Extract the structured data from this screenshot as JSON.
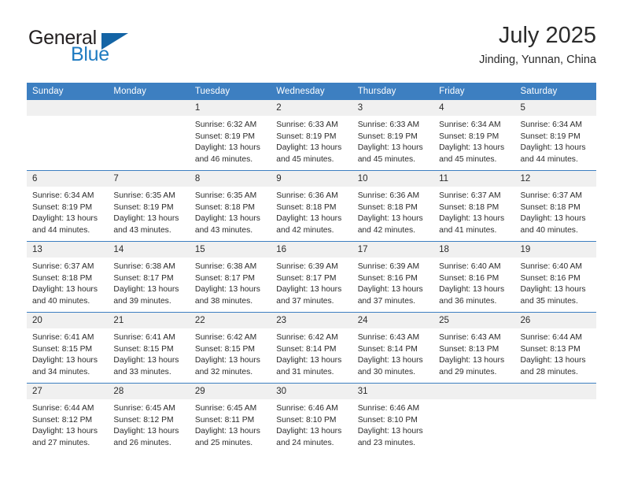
{
  "brand": {
    "name_top": "General",
    "name_bottom": "Blue",
    "color_dark": "#231f20",
    "color_blue": "#1f7bc1",
    "triangle_color": "#1464a5"
  },
  "header": {
    "title": "July 2025",
    "subtitle": "Jinding, Yunnan, China"
  },
  "theme": {
    "header_bar": "#3d7fc1",
    "daynum_bg": "#f0f0f0",
    "text": "#2b2b2b"
  },
  "weekday_headers": [
    "Sunday",
    "Monday",
    "Tuesday",
    "Wednesday",
    "Thursday",
    "Friday",
    "Saturday"
  ],
  "weeks": [
    [
      {
        "day": "",
        "sunrise": "",
        "sunset": "",
        "daylight_line1": "",
        "daylight_line2": ""
      },
      {
        "day": "",
        "sunrise": "",
        "sunset": "",
        "daylight_line1": "",
        "daylight_line2": ""
      },
      {
        "day": "1",
        "sunrise": "Sunrise: 6:32 AM",
        "sunset": "Sunset: 8:19 PM",
        "daylight_line1": "Daylight: 13 hours",
        "daylight_line2": "and 46 minutes."
      },
      {
        "day": "2",
        "sunrise": "Sunrise: 6:33 AM",
        "sunset": "Sunset: 8:19 PM",
        "daylight_line1": "Daylight: 13 hours",
        "daylight_line2": "and 45 minutes."
      },
      {
        "day": "3",
        "sunrise": "Sunrise: 6:33 AM",
        "sunset": "Sunset: 8:19 PM",
        "daylight_line1": "Daylight: 13 hours",
        "daylight_line2": "and 45 minutes."
      },
      {
        "day": "4",
        "sunrise": "Sunrise: 6:34 AM",
        "sunset": "Sunset: 8:19 PM",
        "daylight_line1": "Daylight: 13 hours",
        "daylight_line2": "and 45 minutes."
      },
      {
        "day": "5",
        "sunrise": "Sunrise: 6:34 AM",
        "sunset": "Sunset: 8:19 PM",
        "daylight_line1": "Daylight: 13 hours",
        "daylight_line2": "and 44 minutes."
      }
    ],
    [
      {
        "day": "6",
        "sunrise": "Sunrise: 6:34 AM",
        "sunset": "Sunset: 8:19 PM",
        "daylight_line1": "Daylight: 13 hours",
        "daylight_line2": "and 44 minutes."
      },
      {
        "day": "7",
        "sunrise": "Sunrise: 6:35 AM",
        "sunset": "Sunset: 8:19 PM",
        "daylight_line1": "Daylight: 13 hours",
        "daylight_line2": "and 43 minutes."
      },
      {
        "day": "8",
        "sunrise": "Sunrise: 6:35 AM",
        "sunset": "Sunset: 8:18 PM",
        "daylight_line1": "Daylight: 13 hours",
        "daylight_line2": "and 43 minutes."
      },
      {
        "day": "9",
        "sunrise": "Sunrise: 6:36 AM",
        "sunset": "Sunset: 8:18 PM",
        "daylight_line1": "Daylight: 13 hours",
        "daylight_line2": "and 42 minutes."
      },
      {
        "day": "10",
        "sunrise": "Sunrise: 6:36 AM",
        "sunset": "Sunset: 8:18 PM",
        "daylight_line1": "Daylight: 13 hours",
        "daylight_line2": "and 42 minutes."
      },
      {
        "day": "11",
        "sunrise": "Sunrise: 6:37 AM",
        "sunset": "Sunset: 8:18 PM",
        "daylight_line1": "Daylight: 13 hours",
        "daylight_line2": "and 41 minutes."
      },
      {
        "day": "12",
        "sunrise": "Sunrise: 6:37 AM",
        "sunset": "Sunset: 8:18 PM",
        "daylight_line1": "Daylight: 13 hours",
        "daylight_line2": "and 40 minutes."
      }
    ],
    [
      {
        "day": "13",
        "sunrise": "Sunrise: 6:37 AM",
        "sunset": "Sunset: 8:18 PM",
        "daylight_line1": "Daylight: 13 hours",
        "daylight_line2": "and 40 minutes."
      },
      {
        "day": "14",
        "sunrise": "Sunrise: 6:38 AM",
        "sunset": "Sunset: 8:17 PM",
        "daylight_line1": "Daylight: 13 hours",
        "daylight_line2": "and 39 minutes."
      },
      {
        "day": "15",
        "sunrise": "Sunrise: 6:38 AM",
        "sunset": "Sunset: 8:17 PM",
        "daylight_line1": "Daylight: 13 hours",
        "daylight_line2": "and 38 minutes."
      },
      {
        "day": "16",
        "sunrise": "Sunrise: 6:39 AM",
        "sunset": "Sunset: 8:17 PM",
        "daylight_line1": "Daylight: 13 hours",
        "daylight_line2": "and 37 minutes."
      },
      {
        "day": "17",
        "sunrise": "Sunrise: 6:39 AM",
        "sunset": "Sunset: 8:16 PM",
        "daylight_line1": "Daylight: 13 hours",
        "daylight_line2": "and 37 minutes."
      },
      {
        "day": "18",
        "sunrise": "Sunrise: 6:40 AM",
        "sunset": "Sunset: 8:16 PM",
        "daylight_line1": "Daylight: 13 hours",
        "daylight_line2": "and 36 minutes."
      },
      {
        "day": "19",
        "sunrise": "Sunrise: 6:40 AM",
        "sunset": "Sunset: 8:16 PM",
        "daylight_line1": "Daylight: 13 hours",
        "daylight_line2": "and 35 minutes."
      }
    ],
    [
      {
        "day": "20",
        "sunrise": "Sunrise: 6:41 AM",
        "sunset": "Sunset: 8:15 PM",
        "daylight_line1": "Daylight: 13 hours",
        "daylight_line2": "and 34 minutes."
      },
      {
        "day": "21",
        "sunrise": "Sunrise: 6:41 AM",
        "sunset": "Sunset: 8:15 PM",
        "daylight_line1": "Daylight: 13 hours",
        "daylight_line2": "and 33 minutes."
      },
      {
        "day": "22",
        "sunrise": "Sunrise: 6:42 AM",
        "sunset": "Sunset: 8:15 PM",
        "daylight_line1": "Daylight: 13 hours",
        "daylight_line2": "and 32 minutes."
      },
      {
        "day": "23",
        "sunrise": "Sunrise: 6:42 AM",
        "sunset": "Sunset: 8:14 PM",
        "daylight_line1": "Daylight: 13 hours",
        "daylight_line2": "and 31 minutes."
      },
      {
        "day": "24",
        "sunrise": "Sunrise: 6:43 AM",
        "sunset": "Sunset: 8:14 PM",
        "daylight_line1": "Daylight: 13 hours",
        "daylight_line2": "and 30 minutes."
      },
      {
        "day": "25",
        "sunrise": "Sunrise: 6:43 AM",
        "sunset": "Sunset: 8:13 PM",
        "daylight_line1": "Daylight: 13 hours",
        "daylight_line2": "and 29 minutes."
      },
      {
        "day": "26",
        "sunrise": "Sunrise: 6:44 AM",
        "sunset": "Sunset: 8:13 PM",
        "daylight_line1": "Daylight: 13 hours",
        "daylight_line2": "and 28 minutes."
      }
    ],
    [
      {
        "day": "27",
        "sunrise": "Sunrise: 6:44 AM",
        "sunset": "Sunset: 8:12 PM",
        "daylight_line1": "Daylight: 13 hours",
        "daylight_line2": "and 27 minutes."
      },
      {
        "day": "28",
        "sunrise": "Sunrise: 6:45 AM",
        "sunset": "Sunset: 8:12 PM",
        "daylight_line1": "Daylight: 13 hours",
        "daylight_line2": "and 26 minutes."
      },
      {
        "day": "29",
        "sunrise": "Sunrise: 6:45 AM",
        "sunset": "Sunset: 8:11 PM",
        "daylight_line1": "Daylight: 13 hours",
        "daylight_line2": "and 25 minutes."
      },
      {
        "day": "30",
        "sunrise": "Sunrise: 6:46 AM",
        "sunset": "Sunset: 8:10 PM",
        "daylight_line1": "Daylight: 13 hours",
        "daylight_line2": "and 24 minutes."
      },
      {
        "day": "31",
        "sunrise": "Sunrise: 6:46 AM",
        "sunset": "Sunset: 8:10 PM",
        "daylight_line1": "Daylight: 13 hours",
        "daylight_line2": "and 23 minutes."
      },
      {
        "day": "",
        "sunrise": "",
        "sunset": "",
        "daylight_line1": "",
        "daylight_line2": ""
      },
      {
        "day": "",
        "sunrise": "",
        "sunset": "",
        "daylight_line1": "",
        "daylight_line2": ""
      }
    ]
  ]
}
